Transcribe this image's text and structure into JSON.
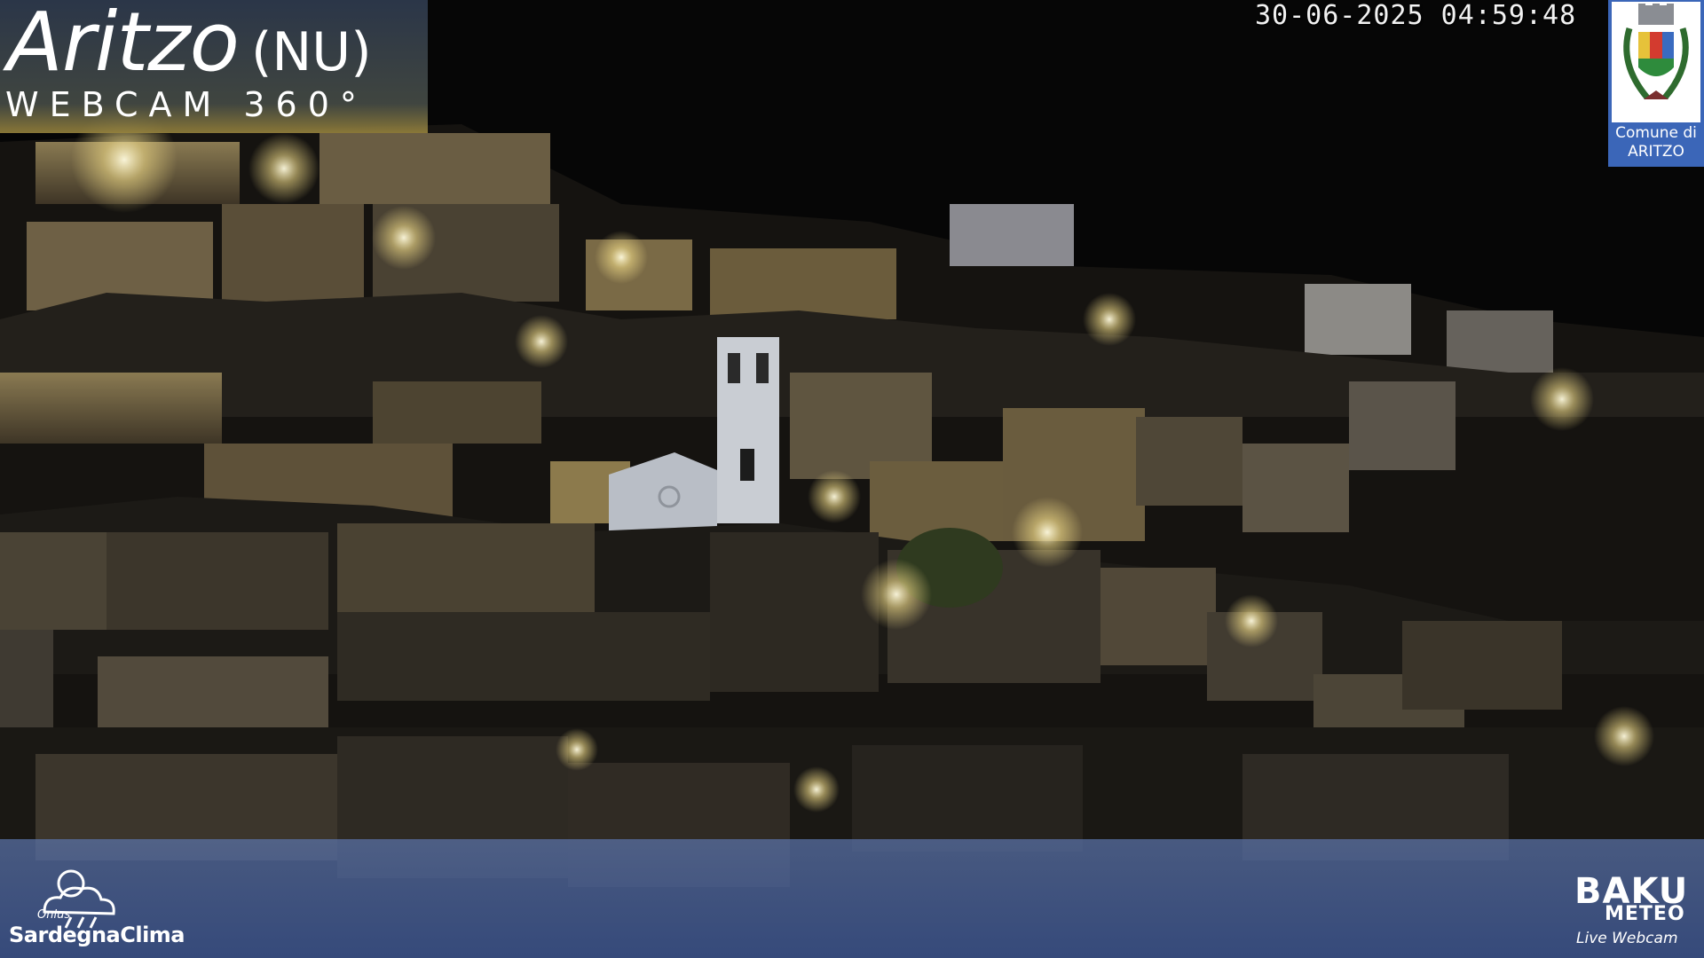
{
  "overlay": {
    "town": "Aritzo",
    "province": "(NU)",
    "subtitle": "WEBCAM 360°",
    "timestamp": "30-06-2025 04:59:48",
    "crest_label_line1": "Comune di",
    "crest_label_line2": "ARITZO"
  },
  "branding": {
    "left_small": "Onlus",
    "left_name": "SardegnaClima",
    "right_name": "BAKU",
    "right_sub": "METEO",
    "right_tag": "Live Webcam"
  },
  "icons": {
    "cloud": "cloud-sun-rain-icon",
    "crest": "municipal-crest-icon",
    "baku_b": "baku-logo-icon"
  },
  "colors": {
    "sky": "#070707",
    "light_warm": "#f4e19a",
    "band": "#4b68a8",
    "crest_bg": "#3b66b8"
  }
}
